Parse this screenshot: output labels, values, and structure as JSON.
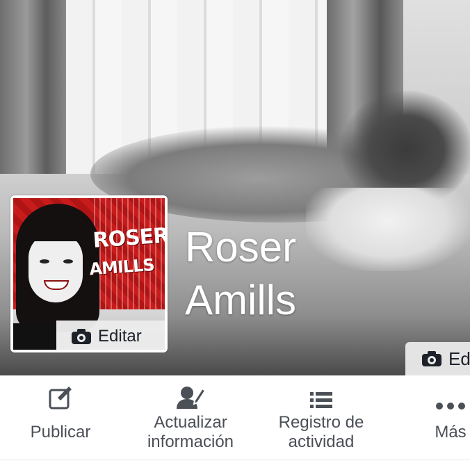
{
  "profile": {
    "name_line1": "Roser",
    "name_line2": "Amills",
    "picture_text_line1": "ROSER",
    "picture_text_line2": "AMILLS",
    "edit_label": "Editar"
  },
  "cover": {
    "edit_label": "Ed"
  },
  "actions": [
    {
      "icon": "edit-square-icon",
      "label_line1": "Publicar",
      "label_line2": ""
    },
    {
      "icon": "user-edit-icon",
      "label_line1": "Actualizar",
      "label_line2": "información"
    },
    {
      "icon": "list-icon",
      "label_line1": "Registro de",
      "label_line2": "actividad"
    },
    {
      "icon": "more-dots-icon",
      "label_line1": "Más",
      "label_line2": ""
    }
  ],
  "colors": {
    "action_text": "#4b4f56",
    "icon": "#4b4f56",
    "edit_bg": "#ebebeb"
  }
}
